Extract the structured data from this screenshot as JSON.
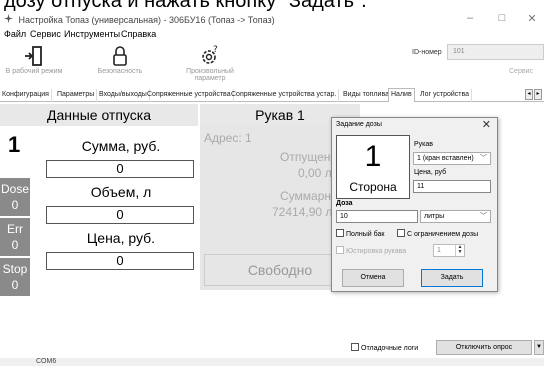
{
  "instruction": "дозу отпуска и нажать кнопку \"Задать\".",
  "window": {
    "title": "Настройка Топаз (универсальная) - 306БУ16 (Топаз -> Топаз)",
    "minimize": "–",
    "maximize": "□",
    "close": "✕"
  },
  "menu": [
    "Файл",
    "Сервис",
    "Инструменты",
    "Справка"
  ],
  "toolbar": {
    "items": [
      {
        "label": "В рабочий режим",
        "icon": "exit-door-icon"
      },
      {
        "label": "Безопасность",
        "icon": "lock-icon"
      },
      {
        "label": "Произвольный параметр",
        "icon": "gear-question-icon"
      }
    ],
    "id_label": "ID-номер",
    "id_value": "101",
    "service_label": "Сервис"
  },
  "tabs": [
    "Конфигурация",
    "Параметры",
    "Входы/выходы",
    "Сопряженные устройства",
    "Сопряженные устройства устар.",
    "Виды топлива",
    "Налив",
    "Лог устройства"
  ],
  "active_tab": "Налив",
  "dispense": {
    "header": "Данные отпуска",
    "side_number": "1",
    "badges": [
      {
        "label": "Dose",
        "value": "0"
      },
      {
        "label": "Err",
        "value": "0"
      },
      {
        "label": "Stop",
        "value": "0"
      }
    ],
    "sum_label": "Сумма, руб.",
    "sum_value": "0",
    "volume_label": "Объем, л",
    "volume_value": "0",
    "price_label": "Цена, руб.",
    "price_value": "0"
  },
  "hose": {
    "header": "Рукав 1",
    "address": "Адрес: 1",
    "dispensed_label": "Отпущено:",
    "dispensed_value": "0,00 л",
    "total_label": "Суммарник:",
    "total_value": "72414,90 л",
    "status": "Свободно"
  },
  "dialog": {
    "title": "Задание дозы",
    "side_number": "1",
    "side_label": "Сторона",
    "hose_label": "Рукав",
    "hose_value": "1 (кран вставлен)",
    "price_label": "Цена, руб",
    "price_value": "11",
    "dose_label": "Доза",
    "dose_value": "10",
    "unit_value": "литры",
    "full_tank_label": "Полный бак",
    "limit_label": "С ограничением дозы",
    "hose_setup_label": "Юстировка рукава",
    "hose_setup_value": "1",
    "cancel_label": "Отмена",
    "submit_label": "Задать"
  },
  "bottom": {
    "debug_logs_label": "Отладочные логи",
    "disable_poll_label": "Отключить опрос"
  },
  "status": {
    "port": "COM6"
  }
}
